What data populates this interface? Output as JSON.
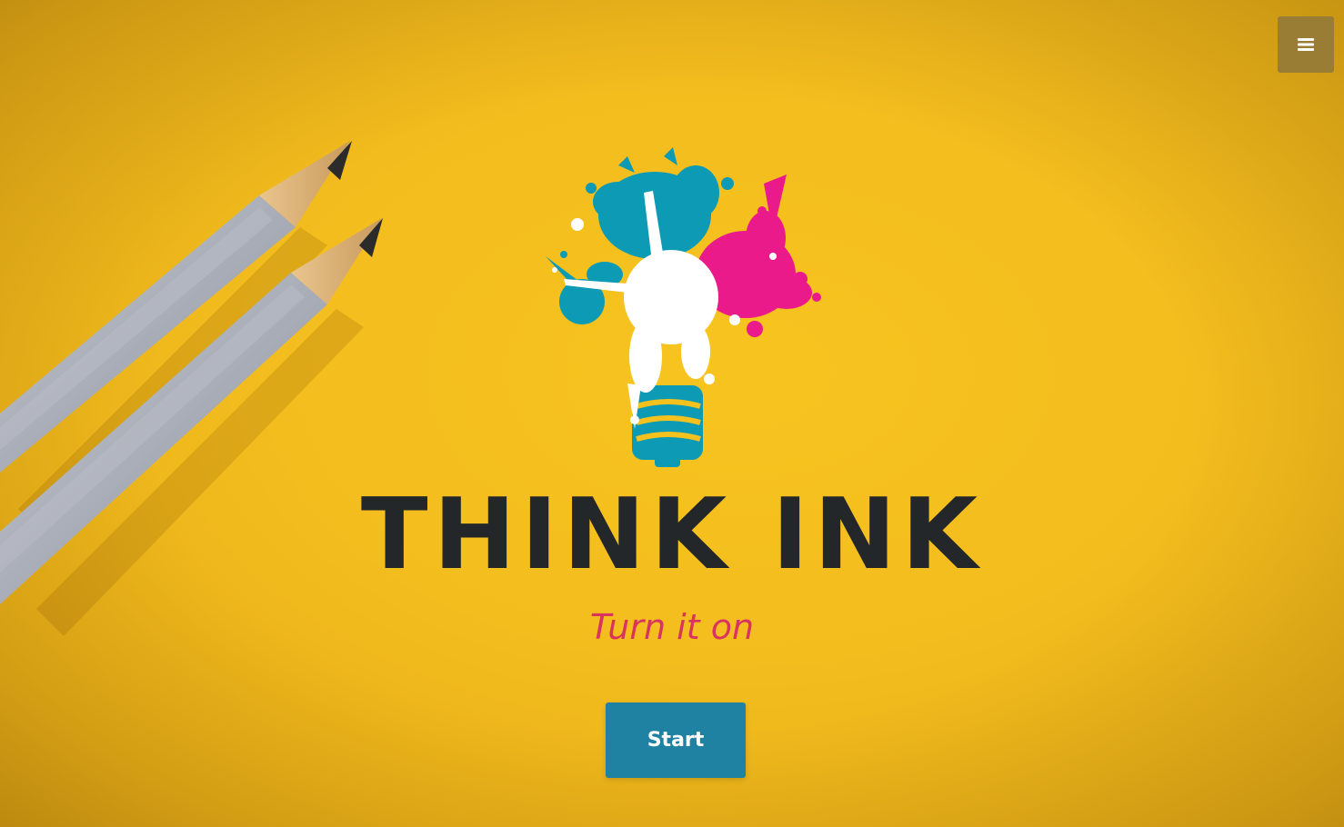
{
  "header": {
    "menu_icon": "hamburger-menu-icon"
  },
  "hero": {
    "title": "THINK INK",
    "tagline": "Turn it on",
    "start_label": "Start"
  },
  "colors": {
    "background": "#f5c11e",
    "title": "#24272a",
    "tagline": "#d9345f",
    "button": "#1f82a3",
    "menu_button": "#9a7d35",
    "splash_teal": "#0c9ab5",
    "splash_pink": "#ea1a8a",
    "splash_white": "#ffffff"
  },
  "icons": {
    "logo": "ink-splash-lightbulb-logo",
    "decor": "pencils-image"
  }
}
